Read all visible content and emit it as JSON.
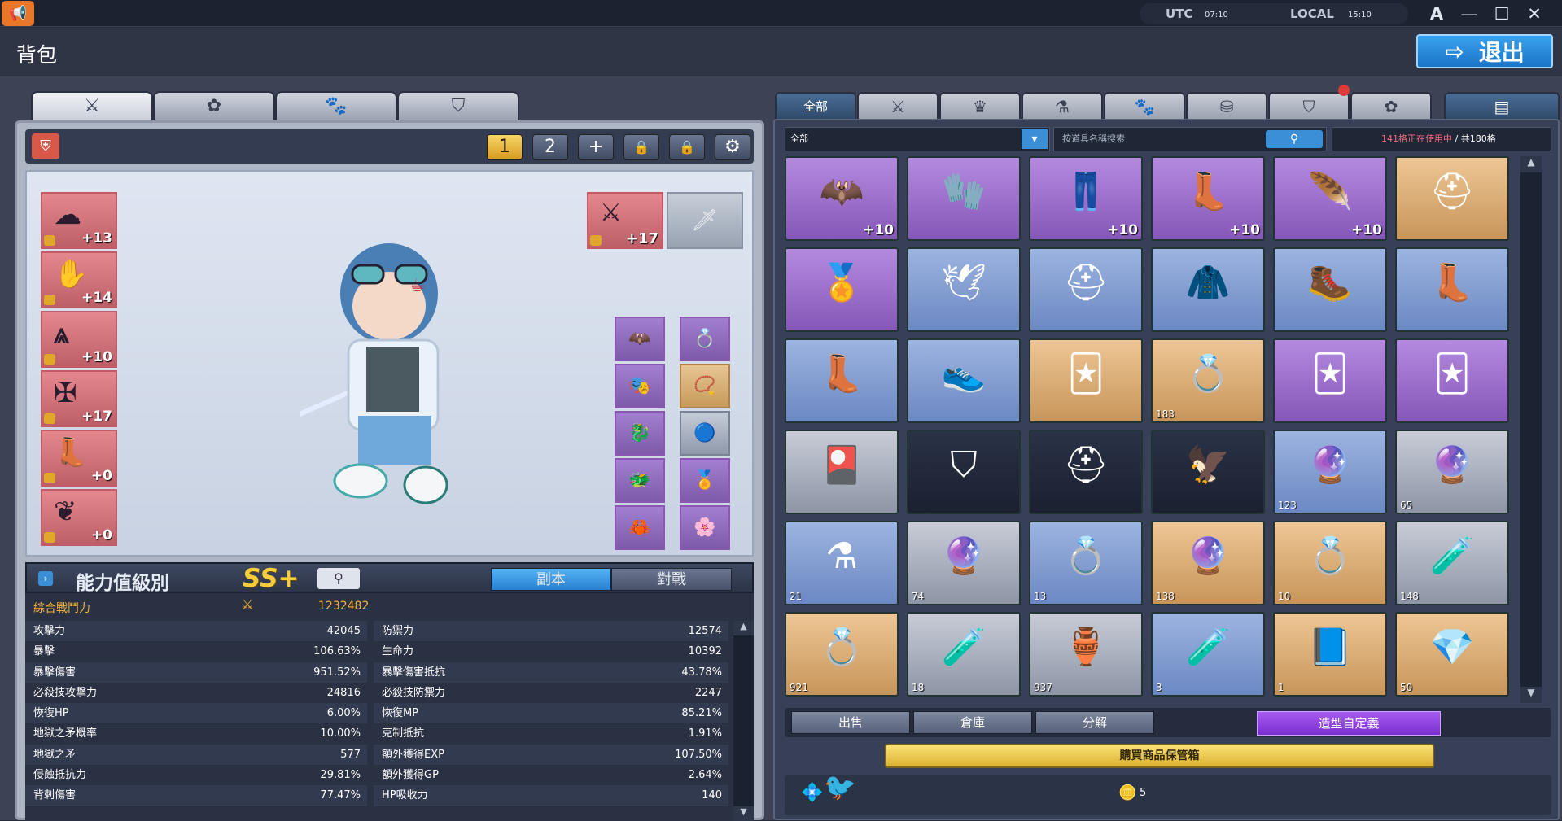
{
  "topbar": {
    "logo_icon": "speaker-icon",
    "utc_label": "UTC",
    "utc_time": "07:10",
    "local_label": "LOCAL",
    "local_time": "15:10",
    "font_btn": "A",
    "min_btn": "—",
    "max_btn": "☐",
    "close_btn": "✕"
  },
  "header": {
    "title": "背包",
    "exit_label": "退出"
  },
  "left_tabs": [
    {
      "icon": "⚔"
    },
    {
      "icon": "✿"
    },
    {
      "icon": "🐾"
    },
    {
      "icon": "⛉"
    }
  ],
  "toolbar": {
    "preset1": "1",
    "preset2": "2",
    "add": "+",
    "lock1": "🔒",
    "lock2": "🔒",
    "settings": "⚙"
  },
  "equip_left": [
    {
      "plus": "+13"
    },
    {
      "plus": "+14"
    },
    {
      "plus": "+10"
    },
    {
      "plus": "+17"
    },
    {
      "plus": "+0"
    },
    {
      "plus": "+0"
    }
  ],
  "weapon_slot": {
    "plus": "+17"
  },
  "stats": {
    "title": "能力值級別",
    "rank": "SS+",
    "tab_dungeon": "副本",
    "tab_pvp": "對戰",
    "combat_label": "綜合戰鬥力",
    "combat_value": "1232482",
    "left": [
      {
        "label": "攻擊力",
        "value": "42045"
      },
      {
        "label": "暴擊",
        "value": "106.63%"
      },
      {
        "label": "暴擊傷害",
        "value": "951.52%"
      },
      {
        "label": "必殺技攻擊力",
        "value": "24816"
      },
      {
        "label": "恢復HP",
        "value": "6.00%"
      },
      {
        "label": "地獄之矛概率",
        "value": "10.00%"
      },
      {
        "label": "地獄之矛",
        "value": "577"
      },
      {
        "label": "侵蝕抵抗力",
        "value": "29.81%"
      },
      {
        "label": "背刺傷害",
        "value": "77.47%"
      }
    ],
    "right": [
      {
        "label": "防禦力",
        "value": "12574"
      },
      {
        "label": "生命力",
        "value": "10392"
      },
      {
        "label": "暴擊傷害抵抗",
        "value": "43.78%"
      },
      {
        "label": "必殺技防禦力",
        "value": "2247"
      },
      {
        "label": "恢復MP",
        "value": "85.21%"
      },
      {
        "label": "克制抵抗",
        "value": "1.91%"
      },
      {
        "label": "額外獲得EXP",
        "value": "107.50%"
      },
      {
        "label": "額外獲得GP",
        "value": "2.64%"
      },
      {
        "label": "HP吸收力",
        "value": "140"
      }
    ]
  },
  "right_tabs": [
    {
      "label": "全部"
    },
    {
      "label": "⚔"
    },
    {
      "label": "♛"
    },
    {
      "label": "⚗"
    },
    {
      "label": "🐾"
    },
    {
      "label": "⛁"
    },
    {
      "label": "⛉"
    },
    {
      "label": "✿"
    },
    {
      "label": "▤"
    }
  ],
  "inventory": {
    "category": "全部",
    "search_placeholder": "按道具名稱搜索",
    "slots_used": "141格正在使用中",
    "slots_total": "/ 共180格",
    "items": [
      {
        "icon": "🦇",
        "color": "purple",
        "plus": "+10",
        "count": ""
      },
      {
        "icon": "🧤",
        "color": "purple",
        "plus": "",
        "count": ""
      },
      {
        "icon": "👖",
        "color": "purple",
        "plus": "+10",
        "count": ""
      },
      {
        "icon": "👢",
        "color": "purple",
        "plus": "+10",
        "count": ""
      },
      {
        "icon": "🪶",
        "color": "purple",
        "plus": "+10",
        "count": ""
      },
      {
        "icon": "⛑",
        "color": "orange",
        "plus": "",
        "count": ""
      },
      {
        "icon": "🏅",
        "color": "purple",
        "plus": "",
        "count": ""
      },
      {
        "icon": "🕊",
        "color": "blue",
        "plus": "",
        "count": ""
      },
      {
        "icon": "⛑",
        "color": "blue",
        "plus": "",
        "count": ""
      },
      {
        "icon": "🧥",
        "color": "blue",
        "plus": "",
        "count": ""
      },
      {
        "icon": "🥾",
        "color": "blue",
        "plus": "",
        "count": ""
      },
      {
        "icon": "👢",
        "color": "blue",
        "plus": "",
        "count": ""
      },
      {
        "icon": "👢",
        "color": "blue",
        "plus": "",
        "count": ""
      },
      {
        "icon": "👟",
        "color": "blue",
        "plus": "",
        "count": ""
      },
      {
        "icon": "🃏",
        "color": "orange",
        "plus": "",
        "count": ""
      },
      {
        "icon": "💍",
        "color": "orange",
        "plus": "",
        "count": "183"
      },
      {
        "icon": "🃏",
        "color": "purple",
        "plus": "",
        "count": ""
      },
      {
        "icon": "🃏",
        "color": "purple",
        "plus": "",
        "count": ""
      },
      {
        "icon": "🎴",
        "color": "gray",
        "plus": "",
        "count": ""
      },
      {
        "icon": "⛉",
        "color": "dark",
        "plus": "",
        "count": ""
      },
      {
        "icon": "⛑",
        "color": "dark",
        "plus": "",
        "count": ""
      },
      {
        "icon": "🦅",
        "color": "dark",
        "plus": "",
        "count": ""
      },
      {
        "icon": "🔮",
        "color": "blue",
        "plus": "",
        "count": "123"
      },
      {
        "icon": "🔮",
        "color": "gray",
        "plus": "",
        "count": "65"
      },
      {
        "icon": "⚗",
        "color": "blue",
        "plus": "",
        "count": "21"
      },
      {
        "icon": "🔮",
        "color": "gray",
        "plus": "",
        "count": "74"
      },
      {
        "icon": "💍",
        "color": "blue",
        "plus": "",
        "count": "13"
      },
      {
        "icon": "🔮",
        "color": "orange",
        "plus": "",
        "count": "138"
      },
      {
        "icon": "💍",
        "color": "orange",
        "plus": "",
        "count": "10"
      },
      {
        "icon": "🧪",
        "color": "gray",
        "plus": "",
        "count": "148"
      },
      {
        "icon": "💍",
        "color": "orange",
        "plus": "",
        "count": "921"
      },
      {
        "icon": "🧪",
        "color": "gray",
        "plus": "",
        "count": "18"
      },
      {
        "icon": "🏺",
        "color": "gray",
        "plus": "",
        "count": "937"
      },
      {
        "icon": "🧪",
        "color": "blue",
        "plus": "",
        "count": "3"
      },
      {
        "icon": "📘",
        "color": "orange",
        "plus": "",
        "count": "1"
      },
      {
        "icon": "💎",
        "color": "orange",
        "plus": "",
        "count": "50"
      }
    ],
    "sell_label": "出售",
    "warehouse_label": "倉庫",
    "dismantle_label": "分解",
    "customize_label": "造型自定義",
    "buy_label": "購買商品保管箱",
    "currency_value": "5"
  }
}
